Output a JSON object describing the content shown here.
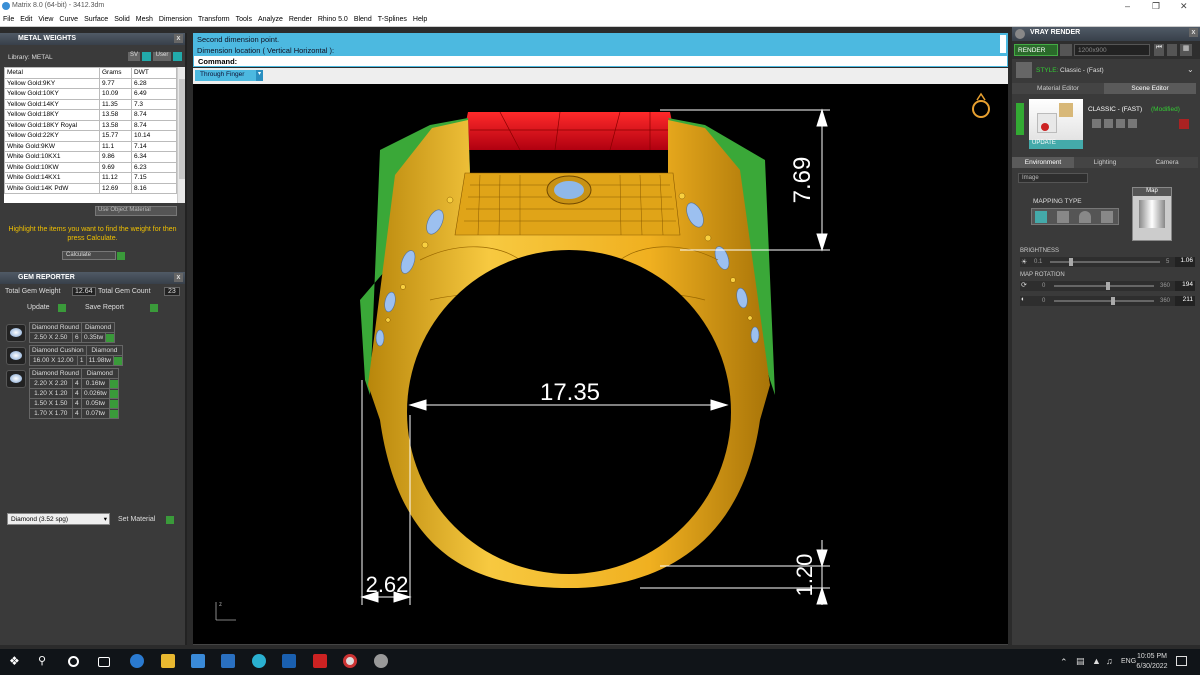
{
  "window": {
    "title": "Matrix 8.0 (64-bit) - 3412.3dm"
  },
  "menu": [
    "File",
    "Edit",
    "View",
    "Curve",
    "Surface",
    "Solid",
    "Mesh",
    "Dimension",
    "Transform",
    "Tools",
    "Analyze",
    "Render",
    "Rhino 5.0",
    "Blend",
    "T-Splines",
    "Help"
  ],
  "metal_weights": {
    "title": "METAL WEIGHTS",
    "library_label": "Library: METAL",
    "columns": [
      "Metal",
      "Grams",
      "DWT"
    ],
    "rows": [
      [
        "Yellow Gold:9KY",
        "9.77",
        "6.28"
      ],
      [
        "Yellow Gold:10KY",
        "10.09",
        "6.49"
      ],
      [
        "Yellow Gold:14KY",
        "11.35",
        "7.3"
      ],
      [
        "Yellow Gold:18KY",
        "13.58",
        "8.74"
      ],
      [
        "Yellow Gold:18KY Royal",
        "13.58",
        "8.74"
      ],
      [
        "Yellow Gold:22KY",
        "15.77",
        "10.14"
      ],
      [
        "White Gold:9KW",
        "11.1",
        "7.14"
      ],
      [
        "White Gold:10KX1",
        "9.86",
        "6.34"
      ],
      [
        "White Gold:10KW",
        "9.69",
        "6.23"
      ],
      [
        "White Gold:14KX1",
        "11.12",
        "7.15"
      ],
      [
        "White Gold:14K PdW",
        "12.69",
        "8.16"
      ]
    ],
    "use_object_material": "Use Object Material",
    "hint": "Highlight the items you want to find the weight for then press Calculate.",
    "calculate": "Calculate"
  },
  "gem_reporter": {
    "title": "GEM REPORTER",
    "total_weight_label": "Total Gem Weight",
    "total_weight": "12.64",
    "total_count_label": "Total Gem Count",
    "total_count": "23",
    "update": "Update",
    "save_report": "Save Report",
    "groups": [
      {
        "shape": "Diamond Round",
        "material": "Diamond",
        "rows": [
          [
            "2.50 X 2.50",
            "6",
            "0.35tw"
          ]
        ]
      },
      {
        "shape": "Diamond Cushion",
        "material": "Diamond",
        "rows": [
          [
            "16.00 X 12.00",
            "1",
            "11.98tw"
          ]
        ]
      },
      {
        "shape": "Diamond Round",
        "material": "Diamond",
        "rows": [
          [
            "2.20 X 2.20",
            "4",
            "0.16tw"
          ],
          [
            "1.20 X 1.20",
            "4",
            "0.026tw"
          ],
          [
            "1.50 X 1.50",
            "4",
            "0.05tw"
          ],
          [
            "1.70 X 1.70",
            "4",
            "0.07tw"
          ]
        ]
      }
    ],
    "material_select": "Diamond     (3.52 spg)",
    "set_material": "Set Material"
  },
  "command": {
    "line1": "Second dimension point.",
    "line2": "Dimension location ( Vertical  Horizontal ):",
    "prompt": "Command:"
  },
  "viewport": {
    "view_label": "Through Finger",
    "dims": {
      "top": "7.69",
      "width": "17.35",
      "thickness": "2.62",
      "bottom": "1.20"
    },
    "axis_label": "z"
  },
  "vray": {
    "title": "VRAY RENDER",
    "render": "RENDER",
    "resolution": "1200x900",
    "style_label": "STYLE:",
    "style": "Classic - (Fast)",
    "tabs": [
      "Material Editor",
      "Scene Editor"
    ],
    "preset_name": "CLASSIC - (FAST)",
    "preset_state": "(Modified)",
    "update": "UPDATE",
    "env_tabs": [
      "Environment",
      "Lighting",
      "Camera"
    ],
    "env_type": "Image",
    "mapping_type": "MAPPING TYPE",
    "map": "Map",
    "brightness": {
      "label": "BRIGHTNESS",
      "min": "0.1",
      "max": "5",
      "value": "1.06",
      "fraction": 0.19
    },
    "map_rotation": {
      "label": "MAP ROTATION",
      "rows": [
        {
          "min": "0",
          "max": "360",
          "value": "194",
          "fraction": 0.54
        },
        {
          "min": "0",
          "max": "360",
          "value": "211",
          "fraction": 0.59
        }
      ]
    }
  },
  "taskbar": {
    "lang": "ENG",
    "time": "10:05 PM",
    "date": "6/30/2022"
  },
  "colors": {
    "metal": "#f0b020",
    "gem_red": "#e8101a",
    "cmd_bg": "#4cb9e0",
    "accent_green": "#3a9a3a"
  }
}
